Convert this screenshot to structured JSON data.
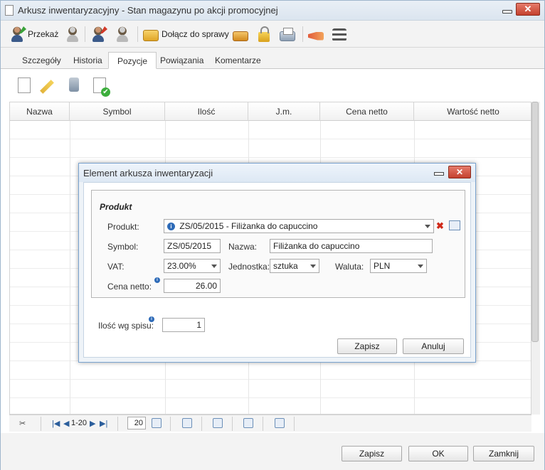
{
  "window": {
    "title": "Arkusz inwentaryzacyjny - Stan magazynu po akcji promocyjnej",
    "close_label": "✕"
  },
  "toolbar": {
    "przekaz_label": "Przekaż",
    "dolacz_label": "Dołącz do sprawy",
    "icons": [
      "person-forward-icon",
      "person-disabled-icon",
      "person-edit-icon",
      "person-link-disabled-icon",
      "folder-attach-icon",
      "folder-remove-icon",
      "lock-icon",
      "printer-icon",
      "megaphone-icon",
      "menu-icon"
    ]
  },
  "tabs": [
    {
      "label": "Szczegóły",
      "active": false
    },
    {
      "label": "Historia",
      "active": false
    },
    {
      "label": "Pozycje",
      "active": true
    },
    {
      "label": "Powiązania",
      "active": false
    },
    {
      "label": "Komentarze",
      "active": false
    }
  ],
  "grid": {
    "columns": [
      "Nazwa",
      "Symbol",
      "Ilość",
      "J.m.",
      "Cena netto",
      "Wartość netto"
    ]
  },
  "pager": {
    "range": "1-20",
    "page_size": "20"
  },
  "footer": {
    "zapisz_label": "Zapisz",
    "ok_label": "OK",
    "zamknij_label": "Zamknij"
  },
  "dialog": {
    "title": "Element arkusza inwentaryzacji",
    "close_label": "✕",
    "section_title": "Produkt",
    "produkt_label": "Produkt:",
    "produkt_value": "ZS/05/2015 - Filiżanka do capuccino",
    "symbol_label": "Symbol:",
    "symbol_value": "ZS/05/2015",
    "nazwa_label": "Nazwa:",
    "nazwa_value": "Filiżanka do capuccino",
    "vat_label": "VAT:",
    "vat_value": "23.00%",
    "jednostka_label": "Jednostka:",
    "jednostka_value": "sztuka",
    "waluta_label": "Waluta:",
    "waluta_value": "PLN",
    "cena_label": "Cena netto:",
    "cena_value": "26.00",
    "ilosc_label": "Ilość wg spisu:",
    "ilosc_value": "1",
    "zapisz_label": "Zapisz",
    "anuluj_label": "Anuluj"
  },
  "colors": {
    "accent": "#2e6bb8",
    "close_red": "#c4412e",
    "titlebar": "#dbe5ef"
  }
}
